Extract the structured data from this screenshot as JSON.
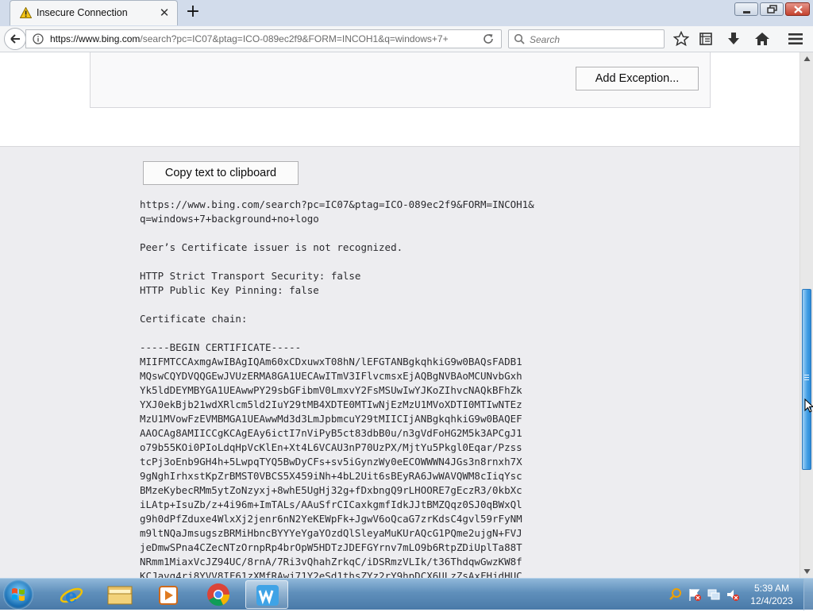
{
  "browser": {
    "tab": {
      "title": "Insecure Connection",
      "close_glyph": "✕"
    },
    "new_tab_glyph": "+",
    "address": {
      "host": "https://www.bing.com",
      "rest": "/search?pc=IC07&ptag=ICO-089ec2f9&FORM=INCOH1&q=windows+7+"
    },
    "search": {
      "placeholder": "Search"
    }
  },
  "page": {
    "add_exception_label": "Add Exception...",
    "copy_label": "Copy text to clipboard",
    "cert_text": "https://www.bing.com/search?pc=IC07&ptag=ICO-089ec2f9&FORM=INCOH1&\nq=windows+7+background+no+logo\n\nPeer’s Certificate issuer is not recognized.\n\nHTTP Strict Transport Security: false\nHTTP Public Key Pinning: false\n\nCertificate chain:\n\n-----BEGIN CERTIFICATE-----\nMIIFMTCCAxmgAwIBAgIQAm60xCDxuwxT08hN/lEFGTANBgkqhkiG9w0BAQsFADB1\nMQswCQYDVQQGEwJVUzERMA8GA1UECAwITmV3IFlvcmsxEjAQBgNVBAoMCUNvbGxh\nYk5ldDEYMBYGA1UEAwwPY29sbGFibmV0LmxvY2FsMSUwIwYJKoZIhvcNAQkBFhZk\nYXJ0ekBjb21wdXRlcm5ld2IuY29tMB4XDTE0MTIwNjEzMzU1MVoXDTI0MTIwNTEz\nMzU1MVowFzEVMBMGA1UEAwwMd3d3LmJpbmcuY29tMIICIjANBgkqhkiG9w0BAQEF\nAAOCAg8AMIICCgKCAgEAy6ictI7nViPyB5ct83dbB0u/n3gVdFoHG2M5k3APCgJ1\no79b55KOi0PIoLdqHpVcKlEn+Xt4L6VCAU3nP70UzPX/MjtYu5Pkgl0Eqar/Pzss\ntcPj3oEnb9GH4h+5LwpqTYQ5BwDyCFs+sv5iGynzWy0eECOWWWN4JGs3n8rnxh7X\n9gNghIrhxstKpZrBMST0VBCS5X459iNh+4bL2Uit6sBEyRA6JwWAVQWM8cIiqYsc\nBMzeKybecRMm5ytZoNzyxj+8whE5UgHj32g+fDxbngQ9rLHOORE7gEczR3/0kbXc\niLAtp+IsuZb/z+4i96m+ImTALs/AAuSfrCICaxkgmfIdkJJtBMZQqz0SJ0qBWxQl\ng9h0dPfZduxe4WlxXj2jenr6nN2YeKEWpFk+JgwV6oQcaG7zrKdsC4gvl59rFyNM\nm9ltNQaJmsugszBRMiHbncBYYYeYgaYOzdQlSleyaMuKUrAQcG1PQme2ujgN+FVJ\njeDmwSPna4CZecNTzOrnpRp4brOpW5HDTzJDEFGYrnv7mLO9b6RtpZDiUplTa88T\nNRmm1MiaxVcJZ94UC/8rnA/7Ri3vQhahZrkqC/iDSRmzVLIk/t36ThdqwGwzKW8f\nKCJavg4ri8YVV8IF61zXMfRAwj71Y2eSd1thsZYz2rY9hpDCX6ULzZsAxFHjdHUC"
  },
  "taskbar": {
    "time": "5:39 AM",
    "date": "12/4/2023"
  }
}
